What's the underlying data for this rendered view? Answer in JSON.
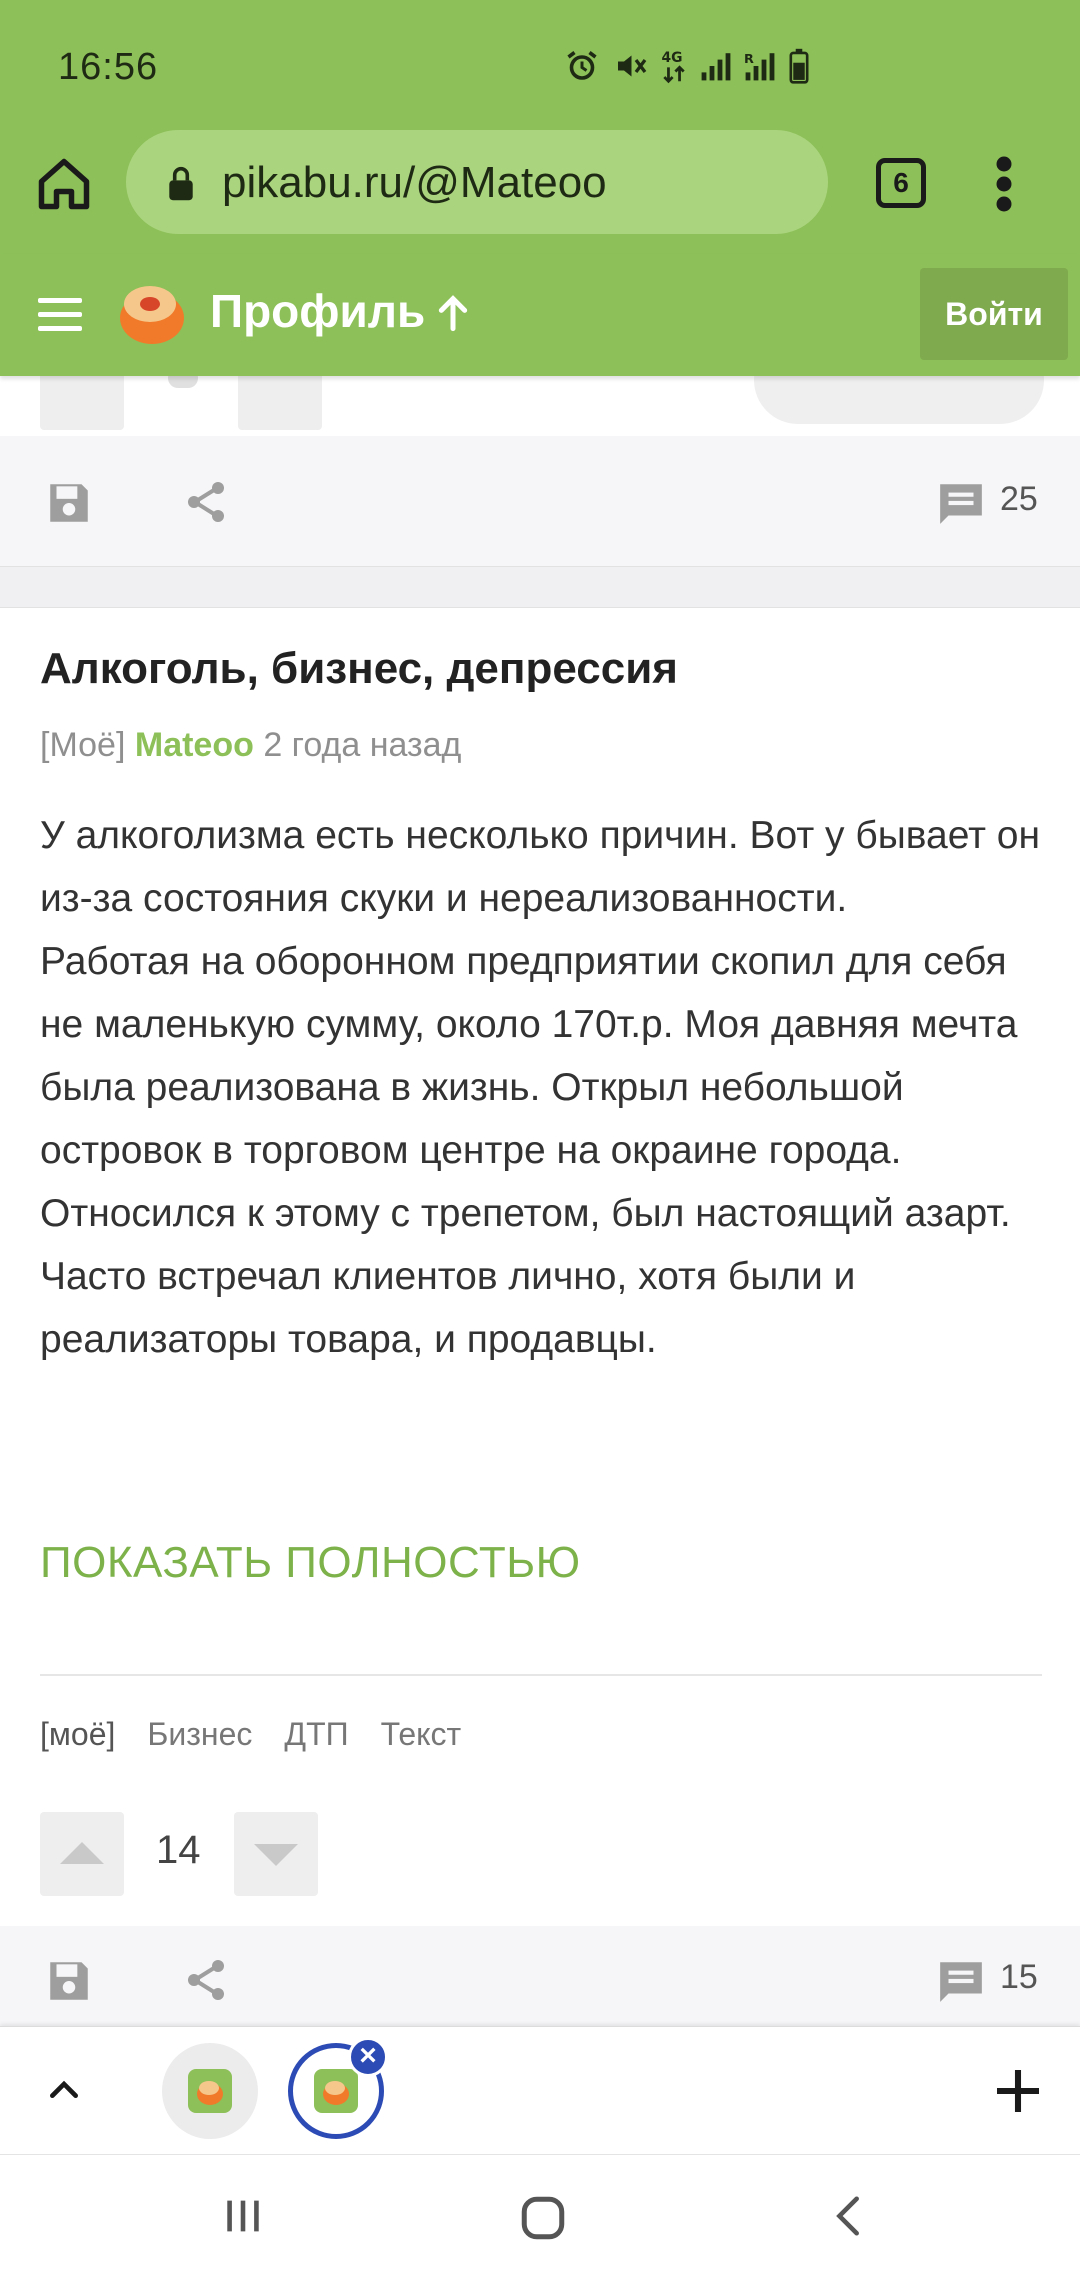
{
  "status_bar": {
    "time": "16:56"
  },
  "browser": {
    "url": "pikabu.ru/@Mateoo",
    "tabs_count": "6"
  },
  "site_header": {
    "title": "Профиль",
    "login_label": "Войти"
  },
  "prev_post": {
    "comments_count": "25"
  },
  "post": {
    "title": "Алкоголь, бизнес, депрессия",
    "tag_prefix": "[Моё]",
    "author": "Mateoo",
    "time_ago": "2 года назад",
    "paragraphs": [
      "У алкоголизма есть несколько причин. Вот у бывает он из-за состояния скуки и нереализованности.",
      "Работая на оборонном предприятии скопил для себя не маленькую сумму, около 170т.р. Моя давняя мечта была реализована в жизнь. Открыл небольшой островок в торговом центре на окраине города. Относился к этому с трепетом, был настоящий азарт. Часто встречал клиентов лично, хотя были и реализаторы товара, и продавцы."
    ],
    "show_more_label": "ПОКАЗАТЬ ПОЛНОСТЬЮ",
    "tags": [
      "[моё]",
      "Бизнес",
      "ДТП",
      "Текст"
    ],
    "rating": "14",
    "comments_count": "15"
  },
  "colors": {
    "brand": "#8dc058",
    "accent_blue": "#2d4bb4"
  }
}
